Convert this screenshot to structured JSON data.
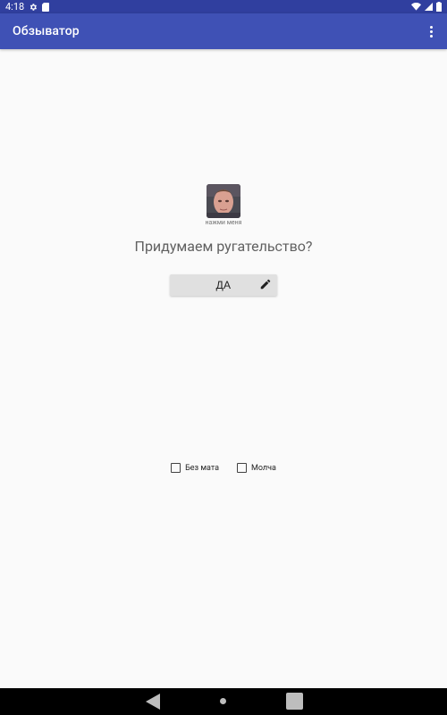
{
  "status_bar": {
    "time": "4:18",
    "icons": [
      "settings-gear-icon",
      "sd-card-icon",
      "wifi-icon",
      "cell-signal-icon",
      "battery-icon"
    ]
  },
  "app_bar": {
    "title": "Обзыватор",
    "menu_icon": "more-vert-icon",
    "color": "#3f51b5",
    "status_color": "#303f9f"
  },
  "main": {
    "avatar_caption": "нажми меня",
    "headline": "Придумаем ругательство?",
    "yes_button_label": "ДА",
    "yes_button_icon": "pencil-icon"
  },
  "options": [
    {
      "label": "Без мата",
      "checked": false
    },
    {
      "label": "Молча",
      "checked": false
    }
  ],
  "nav_bar": {
    "icons": [
      "back-icon",
      "home-icon",
      "recents-icon"
    ]
  }
}
